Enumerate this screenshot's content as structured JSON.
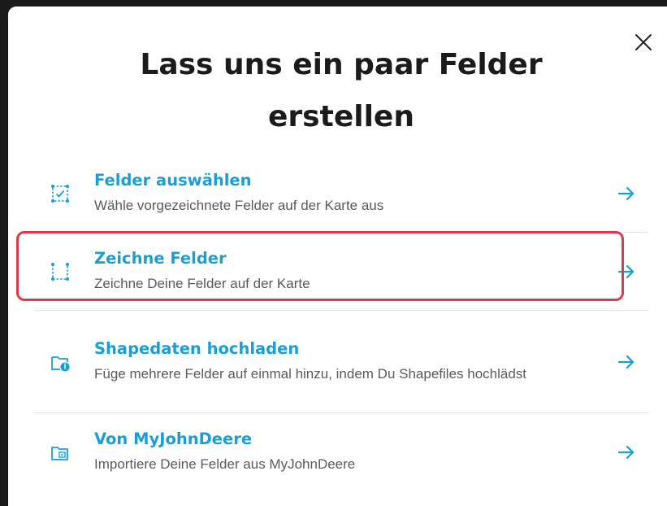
{
  "dialog": {
    "title": "Lass uns ein paar Felder erstellen",
    "close_icon": "close-icon",
    "options": [
      {
        "title": "Felder auswählen",
        "description": "Wähle vorgezeichnete Felder auf der Karte aus",
        "icon": "select-fields-icon"
      },
      {
        "title": "Zeichne Felder",
        "description": "Zeichne Deine Felder auf der Karte",
        "icon": "draw-fields-icon",
        "highlighted": true
      },
      {
        "title": "Shapedaten hochladen",
        "description": "Füge mehrere Felder auf einmal hinzu, indem Du Shapefiles hochlädst",
        "icon": "upload-shapefile-icon"
      },
      {
        "title": "Von MyJohnDeere",
        "description": "Importiere Deine Felder aus MyJohnDeere",
        "icon": "import-myjohndeere-icon"
      }
    ]
  },
  "colors": {
    "accent": "#1a9ed6",
    "highlight": "#e0384f",
    "title": "#1b1b1b",
    "description": "#5a5a5a"
  }
}
